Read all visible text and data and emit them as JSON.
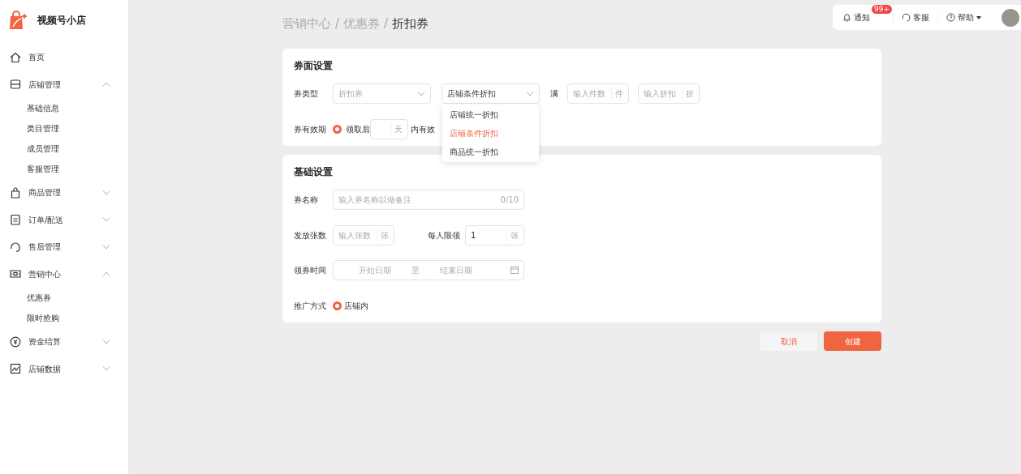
{
  "brand": {
    "name": "视频号小店"
  },
  "sidebar": {
    "items": [
      {
        "label": "首页"
      },
      {
        "label": "店铺管理",
        "expanded": true,
        "children": [
          {
            "label": "基础信息"
          },
          {
            "label": "类目管理"
          },
          {
            "label": "成员管理"
          },
          {
            "label": "客服管理"
          }
        ]
      },
      {
        "label": "商品管理",
        "expanded": false
      },
      {
        "label": "订单/配送",
        "expanded": false
      },
      {
        "label": "售后管理",
        "expanded": false
      },
      {
        "label": "营销中心",
        "expanded": true,
        "children": [
          {
            "label": "优惠券"
          },
          {
            "label": "限时抢购"
          }
        ]
      },
      {
        "label": "资金结算",
        "expanded": false
      },
      {
        "label": "店铺数据",
        "expanded": false
      }
    ]
  },
  "topbar": {
    "notify": {
      "label": "通知",
      "badge": "99+"
    },
    "service": "客服",
    "help": "帮助"
  },
  "breadcrumb": [
    {
      "label": "营销中心",
      "current": false
    },
    {
      "separator": "/",
      "label": "优惠券",
      "current": false
    },
    {
      "separator": "/",
      "label": "折扣券",
      "current": true
    }
  ],
  "coupon_face": {
    "title": "券面设置",
    "type_label": "券类型",
    "type_value": "折扣券",
    "mode_value": "店铺条件折扣",
    "full_label": "满",
    "count_placeholder": "输入件数",
    "count_unit": "件",
    "discount_placeholder": "输入折扣",
    "discount_unit": "折",
    "menu": [
      {
        "label": "店铺统一折扣",
        "selected": false
      },
      {
        "label": "店铺条件折扣",
        "selected": true
      },
      {
        "label": "商品统一折扣",
        "selected": false
      }
    ],
    "validity_label": "券有效期",
    "validity_checked": true,
    "validity_prefix": "领取后",
    "validity_unit": "天",
    "validity_suffix": "内有效"
  },
  "basic": {
    "title": "基础设置",
    "name_label": "券名称",
    "name_placeholder": "输入券名称以做备注",
    "name_counter": "0/10",
    "issue_label": "发放张数",
    "issue_placeholder": "输入张数",
    "issue_unit": "张",
    "limit_label": "每人限领",
    "limit_value": "1",
    "limit_unit": "张",
    "time_label": "领券时间",
    "start_placeholder": "开始日期",
    "to": "至",
    "end_placeholder": "结束日期",
    "promo_label": "推广方式",
    "promo_option": "店铺内",
    "promo_checked": true
  },
  "buttons": {
    "cancel": "取消",
    "create": "创建"
  }
}
